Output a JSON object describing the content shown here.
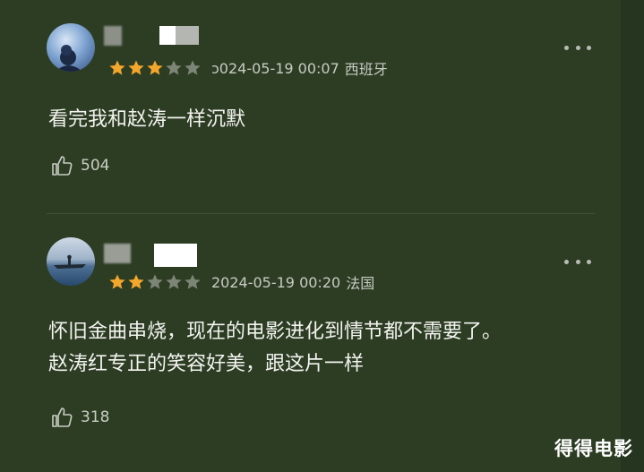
{
  "colors": {
    "background": "#2d3d24",
    "star_filled": "#f2a62b",
    "star_empty": "#7d8577"
  },
  "comments": [
    {
      "rating": 3,
      "max_rating": 5,
      "date": "2024-05-19 00:07",
      "date_display": "ɔ024-05-19 00:07",
      "location": "西班牙",
      "text": "看完我和赵涛一样沉默",
      "likes": "504"
    },
    {
      "rating": 2,
      "max_rating": 5,
      "date": "2024-05-19 00:20",
      "date_display": "2024-05-19 00:20",
      "location": "法国",
      "text_line1": "怀旧金曲串烧，现在的电影进化到情节都不需要了。",
      "text_line2": "赵涛红专正的笑容好美，跟这片一样",
      "likes": "318"
    }
  ],
  "watermark": "得得电影"
}
